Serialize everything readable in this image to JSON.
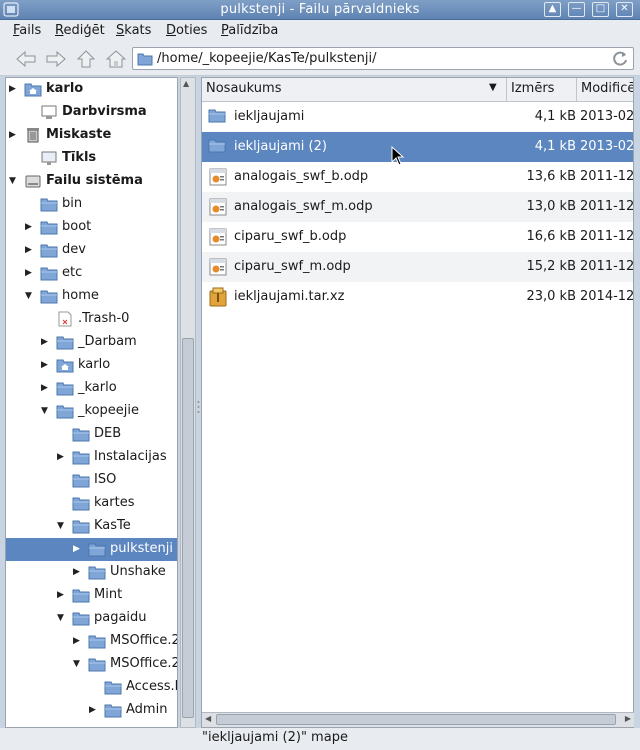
{
  "window": {
    "title": "pulkstenji - Failu pārvaldnieks"
  },
  "menubar": [
    {
      "label": "Fails"
    },
    {
      "label": "Rediģēt"
    },
    {
      "label": "Skats"
    },
    {
      "label": "Doties"
    },
    {
      "label": "Palīdzība"
    }
  ],
  "toolbar": {
    "path": "/home/_kopeejie/KasTe/pulkstenji/"
  },
  "tree": [
    {
      "label": "karlo",
      "bold": true
    },
    {
      "label": "Darbvirsma",
      "bold": true
    },
    {
      "label": "Miskaste",
      "bold": true
    },
    {
      "label": "Tīkls",
      "bold": true
    },
    {
      "label": "Failu sistēma",
      "bold": true
    },
    {
      "label": "bin"
    },
    {
      "label": "boot"
    },
    {
      "label": "dev"
    },
    {
      "label": "etc"
    },
    {
      "label": "home"
    },
    {
      "label": ".Trash-0"
    },
    {
      "label": "_Darbam"
    },
    {
      "label": "karlo"
    },
    {
      "label": "_karlo"
    },
    {
      "label": "_kopeejie"
    },
    {
      "label": "DEB"
    },
    {
      "label": "Instalacijas"
    },
    {
      "label": "ISO"
    },
    {
      "label": "kartes"
    },
    {
      "label": "KasTe"
    },
    {
      "label": "pulkstenji"
    },
    {
      "label": "Unshake"
    },
    {
      "label": "Mint"
    },
    {
      "label": "pagaidu"
    },
    {
      "label": "MSOffice.2"
    },
    {
      "label": "MSOffice.2"
    },
    {
      "label": "Access.l"
    },
    {
      "label": "Admin"
    }
  ],
  "columns": {
    "name": "Nosaukums",
    "size": "Izmērs",
    "modified": "Modificē"
  },
  "files": [
    {
      "name": "iekljaujami",
      "size": "4,1 kB",
      "date": "2013-02-",
      "type": "folder"
    },
    {
      "name": "iekljaujami (2)",
      "size": "4,1 kB",
      "date": "2013-02-",
      "type": "folder"
    },
    {
      "name": "analogais_swf_b.odp",
      "size": "13,6 kB",
      "date": "2011-12-",
      "type": "presentation"
    },
    {
      "name": "analogais_swf_m.odp",
      "size": "13,0 kB",
      "date": "2011-12-",
      "type": "presentation"
    },
    {
      "name": "ciparu_swf_b.odp",
      "size": "16,6 kB",
      "date": "2011-12-",
      "type": "presentation"
    },
    {
      "name": "ciparu_swf_m.odp",
      "size": "15,2 kB",
      "date": "2011-12-",
      "type": "presentation"
    },
    {
      "name": "iekljaujami.tar.xz",
      "size": "23,0 kB",
      "date": "2014-12-",
      "type": "archive"
    }
  ],
  "status": {
    "text": "\"iekljaujami (2)\" mape"
  },
  "colors": {
    "selection": "#5b86bf",
    "titlebar": "#6b8fbd"
  }
}
